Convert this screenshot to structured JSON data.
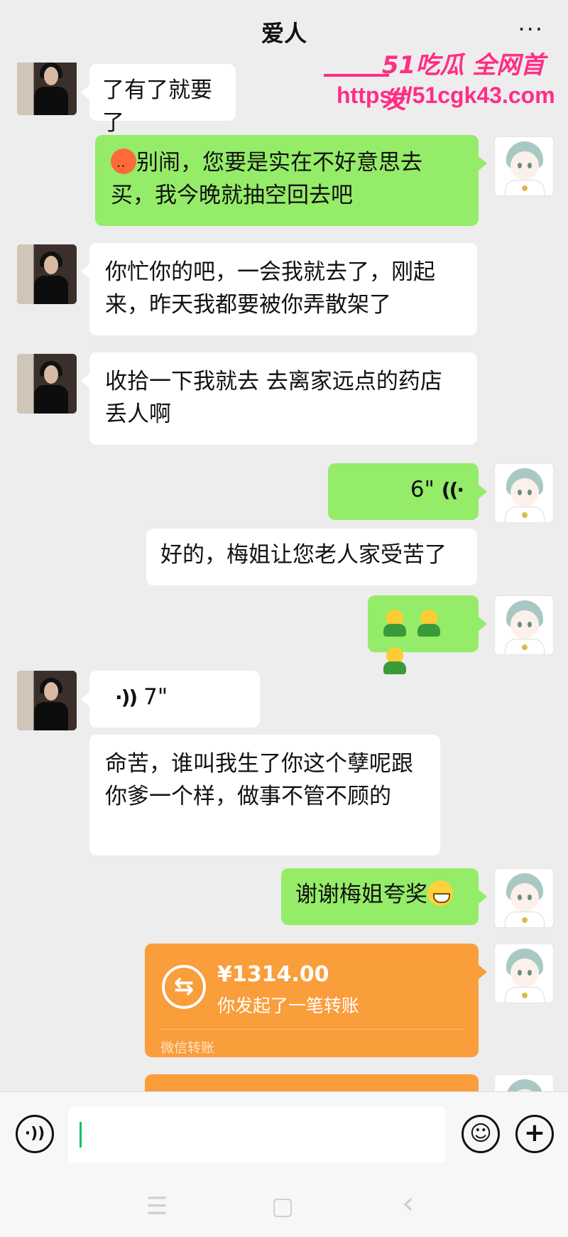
{
  "header": {
    "title": "爱人",
    "more_label": "···"
  },
  "watermark": {
    "brand": "51吃瓜 全网首发",
    "url": "https://51cgk43.com"
  },
  "messages": [
    {
      "text": "了有了就要了"
    },
    {
      "text": "别闹，您要是实在不好意思去买，我今晚就抽空回去吧"
    },
    {
      "text": "你忙你的吧，一会我就去了，刚起来，昨天我都要被你弄散架了"
    },
    {
      "text": "收拾一下我就去 去离家远点的药店 丢人啊"
    },
    {
      "voice_duration": "6\""
    },
    {
      "text": "好的，梅姐让您老人家受苦了"
    },
    {
      "emoji": "hug-emoji x3"
    },
    {
      "voice_duration": "7\""
    },
    {
      "text": "命苦，谁叫我生了你这个孽呢跟你爹一个样，做事不管不顾的"
    },
    {
      "text": "谢谢梅姐夸奖"
    }
  ],
  "transfer": {
    "amount": "¥1314.00",
    "description": "你发起了一笔转账",
    "footer": "微信转账",
    "icon": "⇆"
  },
  "input_bar": {
    "voice_icon": "voice-icon",
    "emoji_icon": "emoji-icon",
    "plus_icon": "plus-icon"
  },
  "nav": {
    "menu": "☰",
    "home": "▢",
    "back": "‹"
  }
}
